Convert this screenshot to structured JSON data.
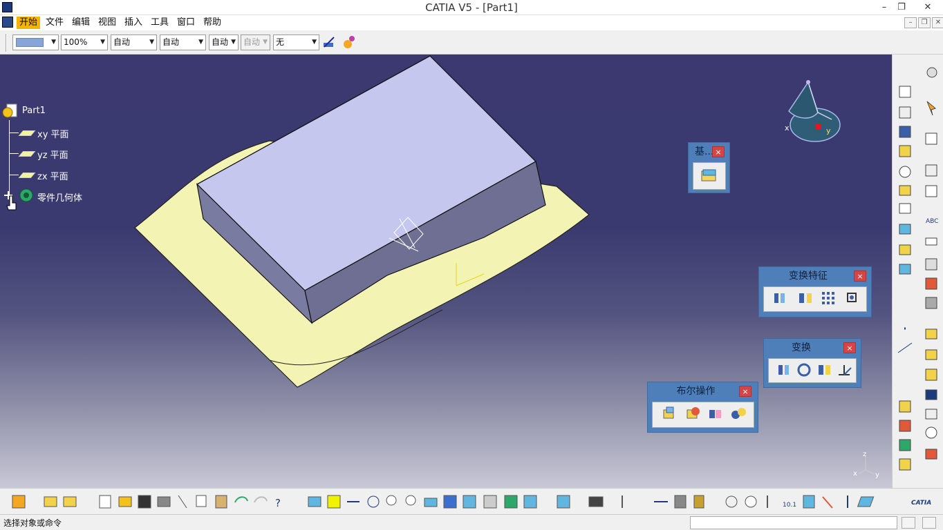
{
  "window": {
    "title": "CATIA V5 - [Part1]",
    "min": "–",
    "restore": "❐",
    "close": "✕"
  },
  "menu": {
    "items": [
      "开始",
      "文件",
      "编辑",
      "视图",
      "插入",
      "工具",
      "窗口",
      "帮助"
    ],
    "active": "开始"
  },
  "mdi": {
    "min": "–",
    "restore": "❐",
    "close": "✕"
  },
  "properties": {
    "color_value": "",
    "transparency": "100%",
    "line_thickness": "自动",
    "line_type": "自动",
    "point_type": "自动",
    "layer_label": "自动",
    "layer": "无"
  },
  "tree": {
    "root": "Part1",
    "items": [
      "xy 平面",
      "yz 平面",
      "zx 平面",
      "零件几何体"
    ]
  },
  "compass": {
    "x": "x",
    "y": "y"
  },
  "toolboxes": {
    "datum": {
      "title": "基..."
    },
    "transform_features": {
      "title": "变换特征"
    },
    "transform": {
      "title": "变换"
    },
    "boolean": {
      "title": "布尔操作"
    },
    "close": "×"
  },
  "axis_triad": {
    "x": "x",
    "y": "y",
    "z": "z"
  },
  "brand": {
    "logo": "CATIA"
  },
  "status": {
    "prompt": "选择对象或命令"
  },
  "colors": {
    "viewport_top": "#3b3970",
    "viewport_bottom": "#c8c8d6",
    "toolbox_blue": "#4f7fb8",
    "menu_active": "#f5b400",
    "surface": "#f2f2b2",
    "solid_top": "#c6c7ee"
  }
}
